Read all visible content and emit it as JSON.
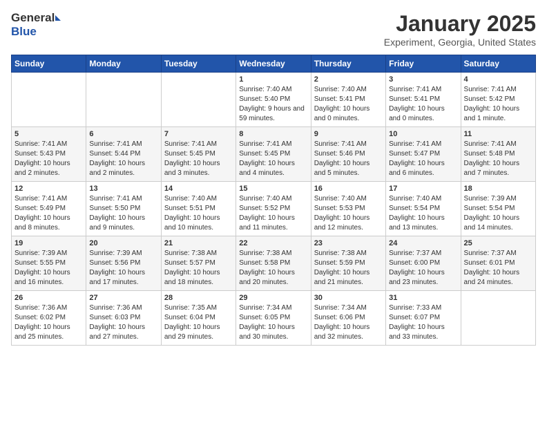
{
  "header": {
    "logo_general": "General",
    "logo_blue": "Blue",
    "month": "January 2025",
    "location": "Experiment, Georgia, United States"
  },
  "days_of_week": [
    "Sunday",
    "Monday",
    "Tuesday",
    "Wednesday",
    "Thursday",
    "Friday",
    "Saturday"
  ],
  "weeks": [
    [
      {
        "day": "",
        "info": ""
      },
      {
        "day": "",
        "info": ""
      },
      {
        "day": "",
        "info": ""
      },
      {
        "day": "1",
        "info": "Sunrise: 7:40 AM\nSunset: 5:40 PM\nDaylight: 9 hours and 59 minutes."
      },
      {
        "day": "2",
        "info": "Sunrise: 7:40 AM\nSunset: 5:41 PM\nDaylight: 10 hours and 0 minutes."
      },
      {
        "day": "3",
        "info": "Sunrise: 7:41 AM\nSunset: 5:41 PM\nDaylight: 10 hours and 0 minutes."
      },
      {
        "day": "4",
        "info": "Sunrise: 7:41 AM\nSunset: 5:42 PM\nDaylight: 10 hours and 1 minute."
      }
    ],
    [
      {
        "day": "5",
        "info": "Sunrise: 7:41 AM\nSunset: 5:43 PM\nDaylight: 10 hours and 2 minutes."
      },
      {
        "day": "6",
        "info": "Sunrise: 7:41 AM\nSunset: 5:44 PM\nDaylight: 10 hours and 2 minutes."
      },
      {
        "day": "7",
        "info": "Sunrise: 7:41 AM\nSunset: 5:45 PM\nDaylight: 10 hours and 3 minutes."
      },
      {
        "day": "8",
        "info": "Sunrise: 7:41 AM\nSunset: 5:45 PM\nDaylight: 10 hours and 4 minutes."
      },
      {
        "day": "9",
        "info": "Sunrise: 7:41 AM\nSunset: 5:46 PM\nDaylight: 10 hours and 5 minutes."
      },
      {
        "day": "10",
        "info": "Sunrise: 7:41 AM\nSunset: 5:47 PM\nDaylight: 10 hours and 6 minutes."
      },
      {
        "day": "11",
        "info": "Sunrise: 7:41 AM\nSunset: 5:48 PM\nDaylight: 10 hours and 7 minutes."
      }
    ],
    [
      {
        "day": "12",
        "info": "Sunrise: 7:41 AM\nSunset: 5:49 PM\nDaylight: 10 hours and 8 minutes."
      },
      {
        "day": "13",
        "info": "Sunrise: 7:41 AM\nSunset: 5:50 PM\nDaylight: 10 hours and 9 minutes."
      },
      {
        "day": "14",
        "info": "Sunrise: 7:40 AM\nSunset: 5:51 PM\nDaylight: 10 hours and 10 minutes."
      },
      {
        "day": "15",
        "info": "Sunrise: 7:40 AM\nSunset: 5:52 PM\nDaylight: 10 hours and 11 minutes."
      },
      {
        "day": "16",
        "info": "Sunrise: 7:40 AM\nSunset: 5:53 PM\nDaylight: 10 hours and 12 minutes."
      },
      {
        "day": "17",
        "info": "Sunrise: 7:40 AM\nSunset: 5:54 PM\nDaylight: 10 hours and 13 minutes."
      },
      {
        "day": "18",
        "info": "Sunrise: 7:39 AM\nSunset: 5:54 PM\nDaylight: 10 hours and 14 minutes."
      }
    ],
    [
      {
        "day": "19",
        "info": "Sunrise: 7:39 AM\nSunset: 5:55 PM\nDaylight: 10 hours and 16 minutes."
      },
      {
        "day": "20",
        "info": "Sunrise: 7:39 AM\nSunset: 5:56 PM\nDaylight: 10 hours and 17 minutes."
      },
      {
        "day": "21",
        "info": "Sunrise: 7:38 AM\nSunset: 5:57 PM\nDaylight: 10 hours and 18 minutes."
      },
      {
        "day": "22",
        "info": "Sunrise: 7:38 AM\nSunset: 5:58 PM\nDaylight: 10 hours and 20 minutes."
      },
      {
        "day": "23",
        "info": "Sunrise: 7:38 AM\nSunset: 5:59 PM\nDaylight: 10 hours and 21 minutes."
      },
      {
        "day": "24",
        "info": "Sunrise: 7:37 AM\nSunset: 6:00 PM\nDaylight: 10 hours and 23 minutes."
      },
      {
        "day": "25",
        "info": "Sunrise: 7:37 AM\nSunset: 6:01 PM\nDaylight: 10 hours and 24 minutes."
      }
    ],
    [
      {
        "day": "26",
        "info": "Sunrise: 7:36 AM\nSunset: 6:02 PM\nDaylight: 10 hours and 25 minutes."
      },
      {
        "day": "27",
        "info": "Sunrise: 7:36 AM\nSunset: 6:03 PM\nDaylight: 10 hours and 27 minutes."
      },
      {
        "day": "28",
        "info": "Sunrise: 7:35 AM\nSunset: 6:04 PM\nDaylight: 10 hours and 29 minutes."
      },
      {
        "day": "29",
        "info": "Sunrise: 7:34 AM\nSunset: 6:05 PM\nDaylight: 10 hours and 30 minutes."
      },
      {
        "day": "30",
        "info": "Sunrise: 7:34 AM\nSunset: 6:06 PM\nDaylight: 10 hours and 32 minutes."
      },
      {
        "day": "31",
        "info": "Sunrise: 7:33 AM\nSunset: 6:07 PM\nDaylight: 10 hours and 33 minutes."
      },
      {
        "day": "",
        "info": ""
      }
    ]
  ]
}
